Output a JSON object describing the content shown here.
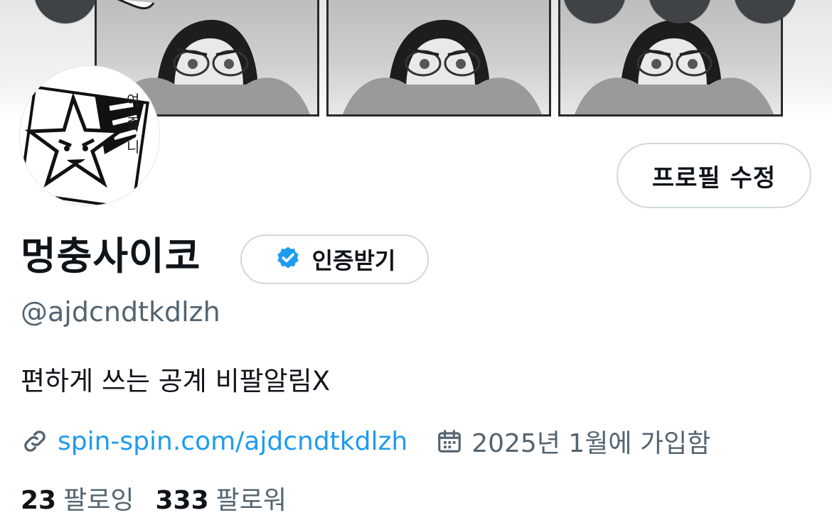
{
  "profile": {
    "edit_button": "프로필 수정",
    "display_name": "멍충사이코",
    "verify_button": "인증받기",
    "handle": "@ajdcndtkdlzh",
    "bio": "편하게 쓰는 공계 비팔알림X",
    "website": "spin-spin.com/ajdcndtkdlzh",
    "joined": "2025년 1월에 가입함",
    "following_count": "23",
    "following_label": "팔로잉",
    "followers_count": "333",
    "followers_label": "팔로워",
    "avatar_text": [
      "여",
      "즐",
      "니"
    ]
  },
  "icons": {
    "verify": "verified-badge-icon",
    "link": "link-icon",
    "calendar": "calendar-icon"
  },
  "colors": {
    "accent": "#1d9bf0",
    "secondary_text": "#536471",
    "border": "#cfd9de"
  }
}
